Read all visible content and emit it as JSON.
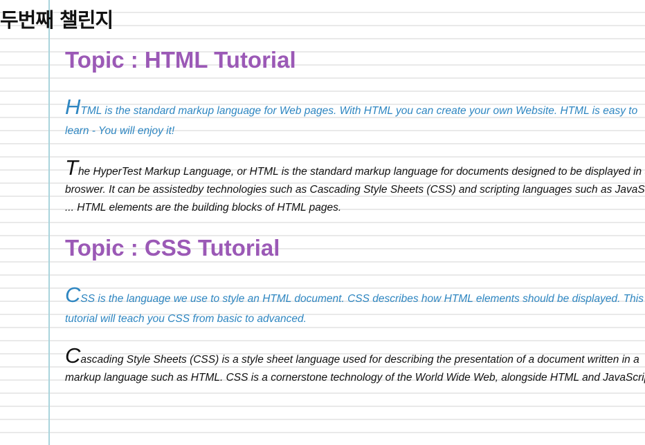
{
  "page": {
    "title": "두번째 챌린지"
  },
  "sections": [
    {
      "topic": "Topic : HTML Tutorial",
      "intro": {
        "initial": "H",
        "text": "TML is the standard markup language for Web pages. With HTML you can create your own Website. HTML is easy to learn - You will enjoy it!"
      },
      "body": {
        "initial": "T",
        "text": "he HyperTest Markup Language, or HTML is the standard markup language for documents designed to be displayed in a web broswer. It can be assistedby technologies such as Cascading Style Sheets (CSS) and scripting languages such as JavaScript. ... HTML elements are the building blocks of HTML pages."
      }
    },
    {
      "topic": "Topic : CSS Tutorial",
      "intro": {
        "initial": "C",
        "text": "SS is the language we use to style an HTML document. CSS describes how HTML elements should be displayed. This tutorial will teach you CSS from basic to advanced."
      },
      "body": {
        "initial": "C",
        "text": "ascading Style Sheets (CSS) is a style sheet language used for describing the presentation of a document written in a markup language such as HTML. CSS is a cornerstone technology of the World Wide Web, alongside HTML and JavaScript."
      }
    }
  ],
  "colors": {
    "topic": "#9b59b6",
    "intro": "#2e86c1",
    "body": "#111111",
    "margin_line": "#a9d4dc",
    "ruled_line": "#e9e9e9"
  }
}
